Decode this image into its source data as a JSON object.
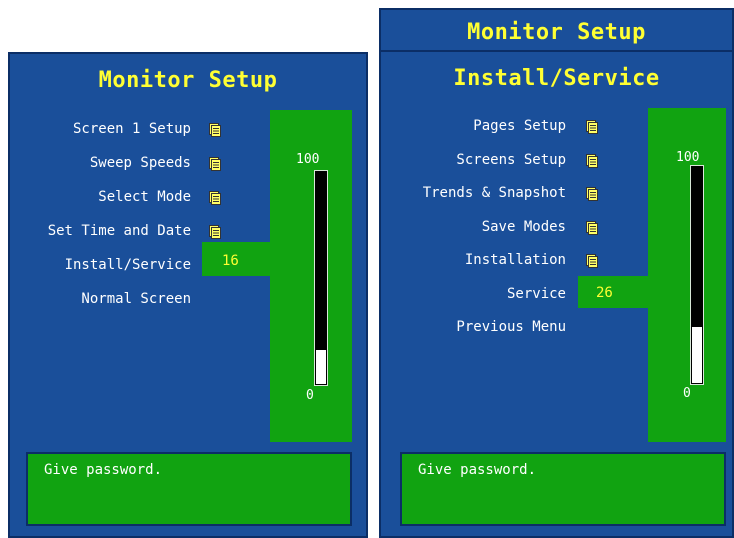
{
  "left_panel": {
    "title": "Monitor Setup",
    "menu": [
      {
        "label": "Screen 1 Setup",
        "has_icon": true
      },
      {
        "label": "Sweep Speeds",
        "has_icon": true
      },
      {
        "label": "Select Mode",
        "has_icon": true
      },
      {
        "label": "Set Time and Date",
        "has_icon": true
      },
      {
        "label": "Install/Service",
        "selected": true
      },
      {
        "label": "Normal Screen"
      }
    ],
    "entry_value": "16",
    "scale_max": "100",
    "scale_min": "0",
    "level_fraction": 0.16,
    "status": "Give password."
  },
  "right_panel": {
    "title": "Monitor Setup",
    "subtitle": "Install/Service",
    "menu": [
      {
        "label": "Pages Setup",
        "has_icon": true
      },
      {
        "label": "Screens Setup",
        "has_icon": true
      },
      {
        "label": "Trends & Snapshot",
        "has_icon": true
      },
      {
        "label": "Save Modes",
        "has_icon": true
      },
      {
        "label": "Installation",
        "has_icon": true
      },
      {
        "label": "Service",
        "selected": true
      },
      {
        "label": "Previous Menu"
      }
    ],
    "entry_value": "26",
    "scale_max": "100",
    "scale_min": "0",
    "level_fraction": 0.26,
    "status": "Give password."
  },
  "colors": {
    "panel_blue": "#1a4f9a",
    "highlight_green": "#11a311",
    "title_yellow": "#ffff33",
    "text_white": "#ffffff"
  },
  "icons": {
    "menu_item_icon": "document-icon"
  }
}
